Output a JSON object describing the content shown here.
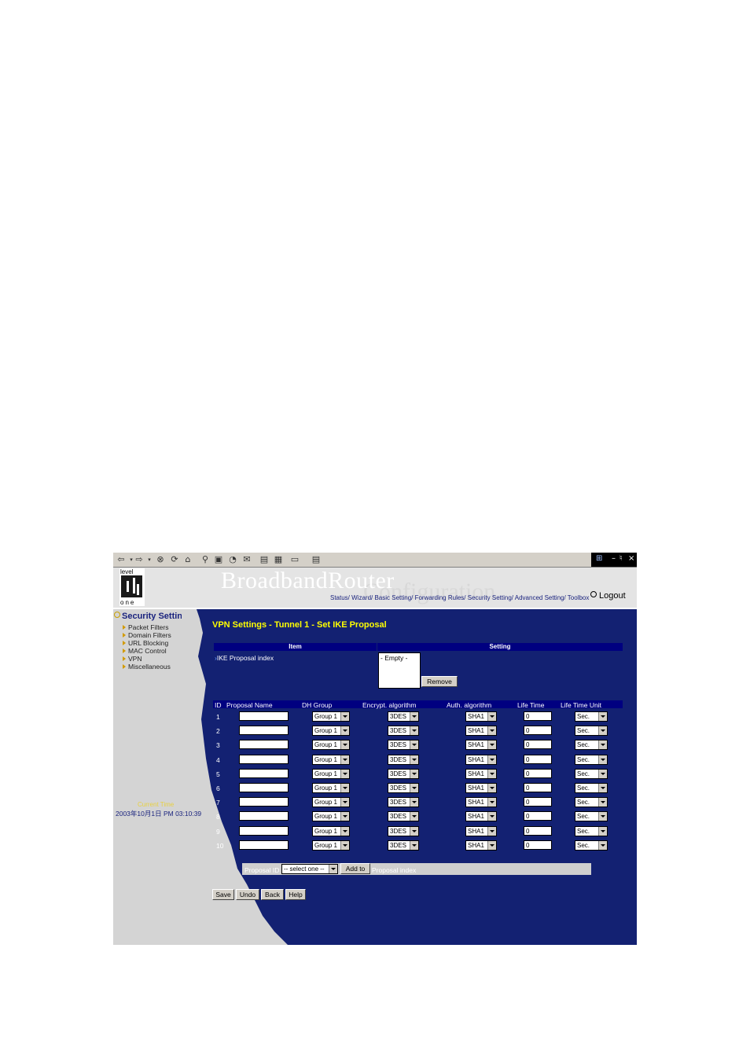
{
  "browser": {
    "toolbar_icons": [
      "back-icon",
      "forward-icon",
      "stop-icon",
      "refresh-icon",
      "home-icon",
      "search-icon",
      "favorites-icon",
      "history-icon",
      "mail-icon",
      "print-icon",
      "edit-icon",
      "discuss-icon"
    ],
    "window_buttons": {
      "minimize": "–",
      "restore": "♮",
      "close": "×"
    }
  },
  "header": {
    "brand_line1": "BroadbandRouter",
    "brand_line2": "Configuration",
    "logo_text_top": "level",
    "logo_text_bottom": "one",
    "nav": "Status/ Wizard/ Basic Setting/ Forwarding Rules/ Security Setting/ Advanced Setting/ Toolbox",
    "logout": "Logout"
  },
  "sidebar": {
    "section_title": "Security Settin",
    "items": [
      {
        "label": "Packet Filters"
      },
      {
        "label": "Domain Filters"
      },
      {
        "label": "URL Blocking"
      },
      {
        "label": "MAC Control"
      },
      {
        "label": "VPN"
      },
      {
        "label": "Miscellaneous"
      }
    ],
    "current_time_label": "Current Time",
    "current_time_value": "2003年10月1日 PM 03:10:39"
  },
  "main": {
    "title": "VPN Settings - Tunnel 1 - Set IKE Proposal",
    "table1": {
      "col_item": "Item",
      "col_setting": "Setting",
      "row_label": "IKE Proposal index",
      "list_value": "- Empty -",
      "remove_label": "Remove"
    },
    "proposal_table": {
      "headers": [
        "ID",
        "Proposal Name",
        "DH Group",
        "Encrypt. algorithm",
        "Auth. algorithm",
        "Life Time",
        "Life Time Unit"
      ],
      "rows": [
        {
          "id": "1",
          "name": "",
          "dh": "Group 1",
          "enc": "3DES",
          "auth": "SHA1",
          "life": "0",
          "unit": "Sec."
        },
        {
          "id": "2",
          "name": "",
          "dh": "Group 1",
          "enc": "3DES",
          "auth": "SHA1",
          "life": "0",
          "unit": "Sec."
        },
        {
          "id": "3",
          "name": "",
          "dh": "Group 1",
          "enc": "3DES",
          "auth": "SHA1",
          "life": "0",
          "unit": "Sec."
        },
        {
          "id": "4",
          "name": "",
          "dh": "Group 1",
          "enc": "3DES",
          "auth": "SHA1",
          "life": "0",
          "unit": "Sec."
        },
        {
          "id": "5",
          "name": "",
          "dh": "Group 1",
          "enc": "3DES",
          "auth": "SHA1",
          "life": "0",
          "unit": "Sec."
        },
        {
          "id": "6",
          "name": "",
          "dh": "Group 1",
          "enc": "3DES",
          "auth": "SHA1",
          "life": "0",
          "unit": "Sec."
        },
        {
          "id": "7",
          "name": "",
          "dh": "Group 1",
          "enc": "3DES",
          "auth": "SHA1",
          "life": "0",
          "unit": "Sec."
        },
        {
          "id": "8",
          "name": "",
          "dh": "Group 1",
          "enc": "3DES",
          "auth": "SHA1",
          "life": "0",
          "unit": "Sec."
        },
        {
          "id": "9",
          "name": "",
          "dh": "Group 1",
          "enc": "3DES",
          "auth": "SHA1",
          "life": "0",
          "unit": "Sec."
        },
        {
          "id": "10",
          "name": "",
          "dh": "Group 1",
          "enc": "3DES",
          "auth": "SHA1",
          "life": "0",
          "unit": "Sec."
        }
      ]
    },
    "add_bar": {
      "proposal_id_label": "Proposal ID",
      "select_value": "-- select one --",
      "add_to_label": "Add to",
      "proposal_index_label": "Proposal index"
    },
    "buttons": {
      "save": "Save",
      "undo": "Undo",
      "back": "Back",
      "help": "Help"
    }
  },
  "colors": {
    "main_blue": "#132172",
    "header_blue": "#000080",
    "title_yellow": "#ffff00",
    "sidebar_gray": "#d4d4d4"
  }
}
